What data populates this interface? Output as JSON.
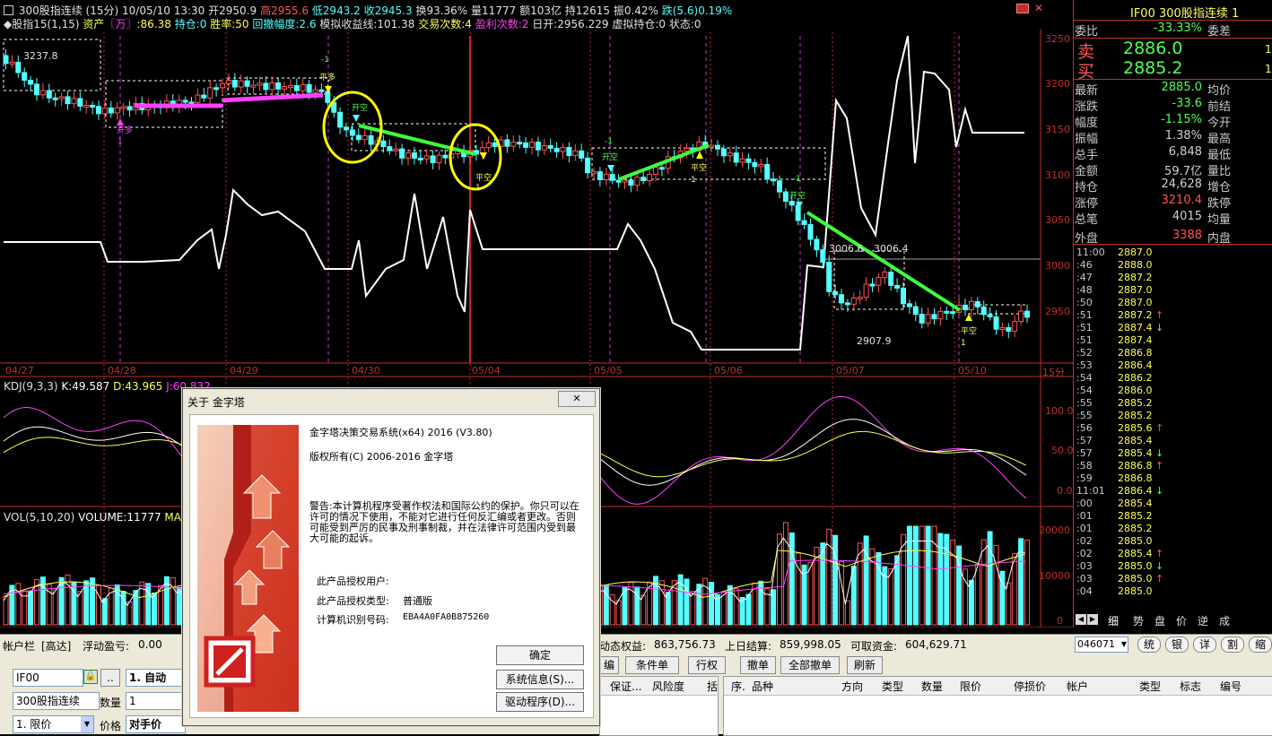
{
  "chart_header": {
    "title": "300股指连续 (15分)",
    "date_time": "10/05/10 13:30",
    "open": "开2950.9",
    "high": "高2955.6",
    "low": "低2943.2",
    "close": "收2945.3",
    "turnover": "换93.36%",
    "volume": "量11777",
    "amount": "额103亿",
    "open_interest": "持12615",
    "amplitude": "振0.42%",
    "change": "跌(5.6)0.19%"
  },
  "strategy_line": {
    "name": "◆股指15(1,15)",
    "assets_label": "资产",
    "assets_unit": "〖万〗",
    "assets_value": ":86.38",
    "position": "持仓:0",
    "win_rate": "胜率:50",
    "drawdown": "回撤幅度:2.6",
    "sim_profit": "模拟收益线:101.38",
    "trades": "交易次数:4",
    "profit_trades": "盈利次数:2",
    "daily_open": "日开:2956.229",
    "virtual_pos": "虚拟持仓:0",
    "status": "状态:0"
  },
  "main_annotations": {
    "price_a": "3237.8",
    "price_b": "3006.6",
    "price_c": "3006.4",
    "price_d": "2907.9",
    "kaiduo": "开多",
    "pingduo": "平多",
    "kaikong": "开空",
    "pingkong": "平空",
    "one": "1",
    "minus_one": "-1"
  },
  "y_axis": [
    "3250",
    "3200",
    "3150",
    "3100",
    "3050",
    "3000",
    "2950"
  ],
  "x_axis": [
    "04/27",
    "04/28",
    "04/29",
    "04/30",
    "05/04",
    "05/05",
    "05/06",
    "05/07",
    "05/10"
  ],
  "period_label": "15分",
  "kdj": {
    "title": "KDJ(9,3,3)",
    "k": "K:49.587",
    "d": "D:43.965",
    "j": "J:60.832",
    "y_axis": [
      "100.0",
      "50.0",
      "0.0"
    ]
  },
  "vol": {
    "title": "VOL(5,10,20)",
    "volume": "VOLUME:11777",
    "ma": "MA",
    "y_axis": [
      "20000",
      "10000",
      "0"
    ]
  },
  "quote": {
    "symbol": "IF00",
    "name": "300股指连续",
    "page": "1",
    "wei_bi_label": "委比",
    "wei_bi": "-33.33%",
    "wei_cha_label": "委差",
    "sell_label": "卖",
    "sell_price": "2886.0",
    "sell_qty": "1",
    "buy_label": "买",
    "buy_price": "2885.2",
    "buy_qty": "1",
    "rows": [
      {
        "l": "最新",
        "v": "2885.0",
        "c": "#54ff54",
        "r": "均价"
      },
      {
        "l": "涨跌",
        "v": "-33.6",
        "c": "#54ff54",
        "r": "前结"
      },
      {
        "l": "幅度",
        "v": "-1.15%",
        "c": "#54ff54",
        "r": "今开"
      },
      {
        "l": "振幅",
        "v": "1.38%",
        "c": "#d0d0d0",
        "r": "最高"
      },
      {
        "l": "总手",
        "v": "6,848",
        "c": "#d0d0d0",
        "r": "最低"
      },
      {
        "l": "金额",
        "v": "59.7亿",
        "c": "#d0d0d0",
        "r": "量比"
      },
      {
        "l": "持仓",
        "v": "24,628",
        "c": "#d0d0d0",
        "r": "增仓"
      },
      {
        "l": "涨停",
        "v": "3210.4",
        "c": "#ff5454",
        "r": "跌停"
      },
      {
        "l": "总笔",
        "v": "4015",
        "c": "#d0d0d0",
        "r": "均量"
      },
      {
        "l": "外盘",
        "v": "3388",
        "c": "#ff5454",
        "r": "内盘"
      }
    ]
  },
  "ticks": [
    {
      "t": "11:00",
      "p": "2887.0",
      "a": ""
    },
    {
      "t": ":46",
      "p": "2888.0",
      "a": ""
    },
    {
      "t": ":47",
      "p": "2887.2",
      "a": ""
    },
    {
      "t": ":48",
      "p": "2887.0",
      "a": ""
    },
    {
      "t": ":50",
      "p": "2887.0",
      "a": ""
    },
    {
      "t": ":51",
      "p": "2887.2",
      "a": "↑"
    },
    {
      "t": ":51",
      "p": "2887.4",
      "a": "↓"
    },
    {
      "t": ":51",
      "p": "2887.4",
      "a": ""
    },
    {
      "t": ":52",
      "p": "2886.8",
      "a": ""
    },
    {
      "t": ":53",
      "p": "2886.4",
      "a": ""
    },
    {
      "t": ":54",
      "p": "2886.2",
      "a": ""
    },
    {
      "t": ":54",
      "p": "2886.0",
      "a": ""
    },
    {
      "t": ":55",
      "p": "2885.2",
      "a": ""
    },
    {
      "t": ":55",
      "p": "2885.2",
      "a": ""
    },
    {
      "t": ":56",
      "p": "2885.6",
      "a": "↑"
    },
    {
      "t": ":57",
      "p": "2885.4",
      "a": ""
    },
    {
      "t": ":57",
      "p": "2885.4",
      "a": "↓"
    },
    {
      "t": ":58",
      "p": "2886.8",
      "a": "↑"
    },
    {
      "t": ":59",
      "p": "2886.8",
      "a": ""
    },
    {
      "t": "11:01",
      "p": "2886.4",
      "a": "↓"
    },
    {
      "t": ":00",
      "p": "2885.4",
      "a": ""
    },
    {
      "t": ":01",
      "p": "2885.2",
      "a": ""
    },
    {
      "t": ":01",
      "p": "2885.2",
      "a": ""
    },
    {
      "t": ":02",
      "p": "2885.0",
      "a": ""
    },
    {
      "t": ":02",
      "p": "2885.4",
      "a": "↑"
    },
    {
      "t": ":03",
      "p": "2885.0",
      "a": "↓"
    },
    {
      "t": ":03",
      "p": "2885.0",
      "a": "↑"
    },
    {
      "t": ":04",
      "p": "2885.0",
      "a": ""
    }
  ],
  "side_tabs": [
    "细",
    "势",
    "盘",
    "价",
    "逆",
    "成"
  ],
  "account_bar": {
    "label": "帐户栏",
    "level": "[高达]",
    "floating_label": "浮动盈亏:",
    "floating_value": "0.00",
    "dynamic_label": "动态权益:",
    "dynamic_value": "863,756.73",
    "last_settle_label": "上日结算:",
    "last_settle_value": "859,998.05",
    "available_label": "可取资金:",
    "available_value": "604,629.71",
    "account_id": "046071",
    "circle_buttons": [
      "统",
      "银",
      "详",
      "割",
      "缩"
    ]
  },
  "order_panel": {
    "symbol": "IF00",
    "dots": "..",
    "mode": "1. 自动",
    "name": "300股指连续",
    "qty_label": "数量",
    "qty": "1",
    "price_type": "1. 限价",
    "price_label": "价格",
    "price": "对手价"
  },
  "order_buttons": [
    "编",
    "条件单",
    "行权",
    "撤单",
    "全部撤单",
    "刷新"
  ],
  "grid_left_headers": [
    "保证...",
    "风险度",
    "括"
  ],
  "grid_right_headers": [
    "序.",
    "品种",
    "方向",
    "类型",
    "数量",
    "限价",
    "停损价",
    "帐户",
    "类型",
    "标志",
    "编号"
  ],
  "dialog": {
    "title": "关于 金字塔",
    "close": "✕",
    "product": "金字塔决策交易系统(x64) 2016 (V3.80)",
    "copyright": "版权所有(C) 2006-2016 金字塔",
    "warning": "警告:本计算机程序受著作权法和国际公约的保护。你只可以在许可的情况下使用，不能对它进行任何反汇编或者更改。否则可能受到严厉的民事及刑事制裁，并在法律许可范围内受到最大可能的起诉。",
    "user_label": "此产品授权用户:",
    "type_label": "此产品授权类型:",
    "type_value": "普通版",
    "machine_label": "计算机识别号码:",
    "machine_value": "EBA4A0FA0B875260",
    "ok": "确定",
    "sysinfo": "系统信息(S)...",
    "driver": "驱动程序(D)..."
  },
  "colors": {
    "up": "#ff5454",
    "down": "#54ffff",
    "axis": "#c0302a",
    "green_line": "#3cff3c",
    "magenta_line": "#ff40ff",
    "circle": "#ffff00"
  }
}
